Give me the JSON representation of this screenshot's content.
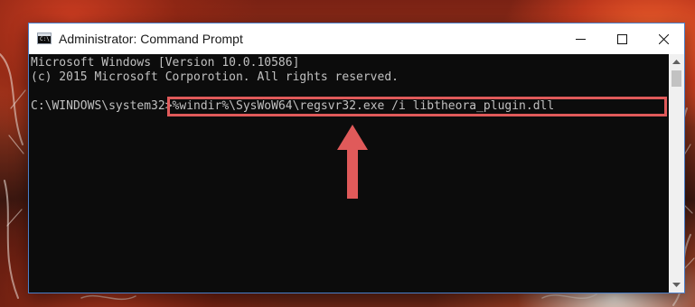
{
  "window": {
    "title": "Administrator: Command Prompt",
    "icon": "cmd-icon",
    "icon_glyph": "C:\\",
    "controls": {
      "minimize": "minimize-icon",
      "maximize": "maximize-icon",
      "close": "close-icon"
    }
  },
  "console": {
    "lines": [
      "Microsoft Windows [Version 10.0.10586]",
      "(c) 2015 Microsoft Corporotion. All rights reserved."
    ],
    "prompt": "C:\\WINDOWS\\system32>",
    "command": "%windir%\\SysWoW64\\regsvr32.exe /i libtheora_plugin.dll"
  },
  "annotation": {
    "highlight_color": "#e05a5a",
    "arrow_color": "#e05a5a",
    "arrow_icon": "up-arrow-icon"
  },
  "scrollbar": {
    "up": "scroll-up-icon",
    "down": "scroll-down-icon"
  }
}
